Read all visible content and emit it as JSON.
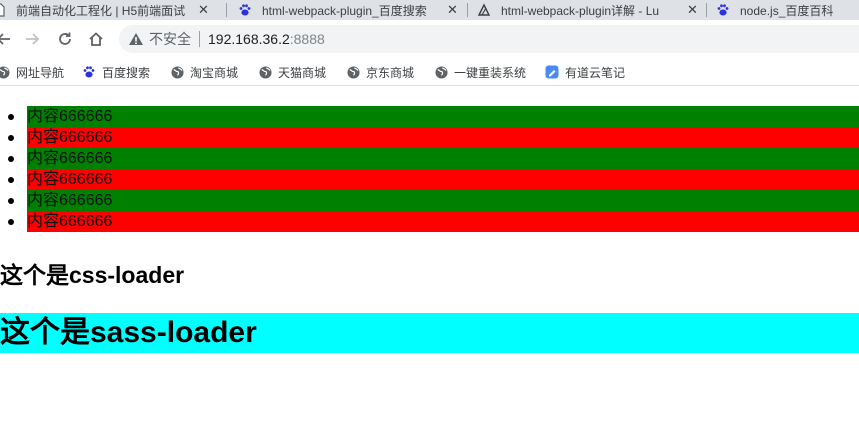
{
  "browser": {
    "tabs": [
      {
        "title": "前端自动化工程化 | H5前端面试",
        "icon": "doc-icon"
      },
      {
        "title": "html-webpack-plugin_百度搜索",
        "icon": "baidu-paw-icon"
      },
      {
        "title": "html-webpack-plugin详解 - Lu",
        "icon": "site-icon"
      },
      {
        "title": "node.js_百度百科",
        "icon": "baidu-paw-icon"
      }
    ],
    "close_glyph": "✕",
    "address": {
      "security_label": "不安全",
      "host": "192.168.36.2",
      "port": ":8888"
    },
    "bookmarks": [
      {
        "label": "网址导航",
        "icon": "globe-icon"
      },
      {
        "label": "百度搜索",
        "icon": "baidu-paw-icon"
      },
      {
        "label": "淘宝商城",
        "icon": "globe-icon"
      },
      {
        "label": "天猫商城",
        "icon": "globe-icon"
      },
      {
        "label": "京东商城",
        "icon": "globe-icon"
      },
      {
        "label": "一键重装系统",
        "icon": "globe-icon"
      },
      {
        "label": "有道云笔记",
        "icon": "youdao-note-icon"
      }
    ]
  },
  "page": {
    "list_items": [
      "内容666666",
      "内容666666",
      "内容666666",
      "内容666666",
      "内容666666",
      "内容666666"
    ],
    "list_colors": [
      "#008000",
      "#ff0000"
    ],
    "css_heading": "这个是css-loader",
    "sass_heading": "这个是sass-loader",
    "sass_bg": "#00ffff"
  }
}
